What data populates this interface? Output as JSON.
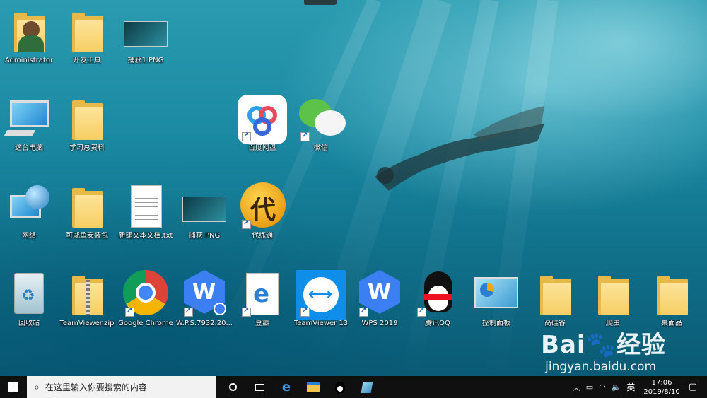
{
  "desktop_icons": [
    {
      "label": "Administrator",
      "icon": "user-folder-icon"
    },
    {
      "label": "开发工具",
      "icon": "folder-icon"
    },
    {
      "label": "捕获1.PNG",
      "icon": "image-file-icon"
    },
    {
      "label": "这台电脑",
      "icon": "computer-icon"
    },
    {
      "label": "学习总资料",
      "icon": "folder-icon"
    },
    {
      "label": "百度网盘",
      "icon": "baidu-netdisk-icon"
    },
    {
      "label": "微信",
      "icon": "wechat-icon"
    },
    {
      "label": "网络",
      "icon": "network-icon"
    },
    {
      "label": "可咸鱼安装包",
      "icon": "folder-icon"
    },
    {
      "label": "新建文本文档.txt",
      "icon": "text-file-icon"
    },
    {
      "label": "捕获.PNG",
      "icon": "image-file-icon"
    },
    {
      "label": "代练通",
      "icon": "dailiantong-icon"
    },
    {
      "label": "回收站",
      "icon": "recycle-bin-icon"
    },
    {
      "label": "TeamViewer.zip",
      "icon": "zip-folder-icon"
    },
    {
      "label": "Google Chrome",
      "icon": "chrome-icon"
    },
    {
      "label": "W.P.S.7932.20...",
      "icon": "wps-installer-icon"
    },
    {
      "label": "豆瓣",
      "icon": "edge-icon"
    },
    {
      "label": "TeamViewer 13",
      "icon": "teamviewer-icon"
    },
    {
      "label": "WPS 2019",
      "icon": "wps-icon"
    },
    {
      "label": "腾讯QQ",
      "icon": "qq-icon"
    },
    {
      "label": "控制面板",
      "icon": "control-panel-icon"
    },
    {
      "label": "高硅谷",
      "icon": "folder-icon"
    },
    {
      "label": "爬虫",
      "icon": "folder-icon"
    },
    {
      "label": "桌面品",
      "icon": "folder-icon"
    }
  ],
  "taskbar": {
    "start_icon": "windows-logo-icon",
    "search_placeholder": "在这里输入你要搜索的内容",
    "pinned": [
      "cortana-icon",
      "task-view-icon",
      "edge-icon",
      "file-explorer-icon",
      "qq-icon",
      "notebook-icon"
    ],
    "tray": {
      "ime": "英",
      "time": "17:06",
      "date": "2019/8/10"
    }
  },
  "watermark": {
    "brand": "Bai",
    "brand_cn": "经验",
    "url": "jingyan.baidu.com"
  }
}
